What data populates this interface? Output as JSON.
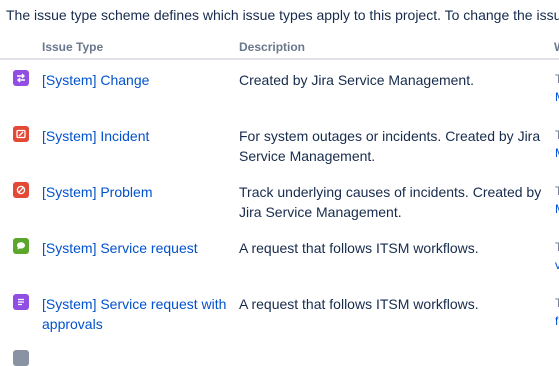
{
  "intro": {
    "text": "The issue type scheme defines which issue types apply to this project. To change the issue"
  },
  "table": {
    "columns": {
      "issue_type": "Issue Type",
      "description": "Description",
      "workflow": "W"
    },
    "rows": [
      {
        "name": "[System] Change",
        "description": "Created by Jira Service Management.",
        "icon": "change-icon",
        "color": "#904ee2"
      },
      {
        "name": "[System] Incident",
        "description": "For system outages or incidents. Created by Jira Service Management.",
        "icon": "incident-icon",
        "color": "#e34935"
      },
      {
        "name": "[System] Problem",
        "description": "Track underlying causes of incidents. Created by Jira Service Management.",
        "icon": "problem-icon",
        "color": "#e34935"
      },
      {
        "name": "[System] Service request",
        "description": "A request that follows ITSM workflows.",
        "icon": "service-request-icon",
        "color": "#5ca72b"
      },
      {
        "name": "[System] Service request with approvals",
        "description": "A request that follows ITSM workflows.",
        "icon": "service-request-approvals-icon",
        "color": "#904ee2"
      }
    ]
  }
}
